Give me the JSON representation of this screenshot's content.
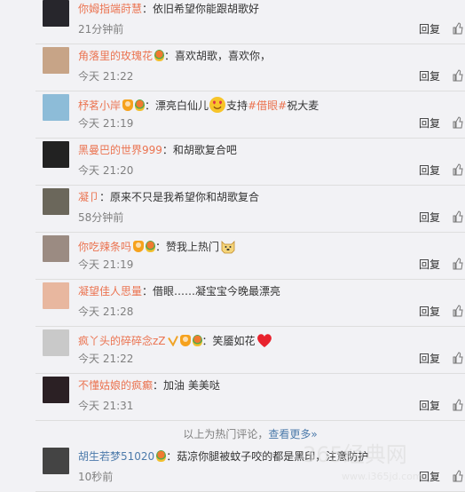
{
  "comments": [
    {
      "user": "你姆指端莳慧",
      "user_color": "#eb7350",
      "badges": [],
      "text": "依旧希望你能跟胡歌好",
      "time": "21分钟前",
      "reply": "回复",
      "avatar": "avatar-dark-portrait"
    },
    {
      "user": "角落里的玫瑰花",
      "user_color": "#eb7350",
      "badges": [
        "balloon"
      ],
      "text": "喜欢胡歌，喜欢你，",
      "time": "今天 21:22",
      "reply": "回复",
      "avatar": "avatar-woman"
    },
    {
      "user": "杼茗小岸",
      "user_color": "#eb7350",
      "badges": [
        "orange",
        "balloon"
      ],
      "text": "漂亮白仙儿",
      "emoji": "heart-eyes-emoji",
      "text2": "支持",
      "tag": "#借眼#",
      "text3": "祝大麦",
      "time": "今天 21:19",
      "reply": "回复",
      "avatar": "avatar-landscape"
    },
    {
      "user": "黑曼巴的世界999",
      "user_color": "#eb7350",
      "badges": [],
      "text": "和胡歌复合吧",
      "time": "今天 21:20",
      "reply": "回复",
      "avatar": "avatar-man-glasses"
    },
    {
      "user": "凝卩",
      "user_color": "#eb7350",
      "badges": [],
      "text": "原来不只是我希望你和胡歌复合",
      "time": "58分钟前",
      "reply": "回复",
      "avatar": "avatar-street"
    },
    {
      "user": "你吃辣条吗",
      "user_color": "#eb7350",
      "badges": [
        "orange",
        "balloon"
      ],
      "text": "赞我上热门",
      "emoji": "doge-emoji",
      "time": "今天 21:19",
      "reply": "回复",
      "avatar": "avatar-interior"
    },
    {
      "user": "凝望佳人思量",
      "user_color": "#eb7350",
      "badges": [],
      "text": "借眼……凝宝宝今晚最漂亮",
      "time": "今天 21:28",
      "reply": "回复",
      "avatar": "avatar-girl"
    },
    {
      "user": "疯丫头的碎碎念zZ",
      "user_color": "#eb7350",
      "badges": [
        "check",
        "orange",
        "balloon"
      ],
      "text": "笑靥如花",
      "emoji": "red-heart-emoji",
      "time": "今天 21:22",
      "reply": "回复",
      "avatar": "avatar-rabbit"
    },
    {
      "user": "不懂姑娘的疯癫",
      "user_color": "#eb7350",
      "badges": [],
      "text": "加油 美美哒",
      "time": "今天 21:31",
      "reply": "回复",
      "avatar": "avatar-portrait-dark-hair"
    },
    {
      "user": "胡生若梦51020",
      "user_color": "#4d7bab",
      "badges": [
        "balloon"
      ],
      "text": "菇凉你腿被蚊子咬的都是黑印，注意防护",
      "time": "10秒前",
      "reply": "回复",
      "avatar": "avatar-dark-figure"
    }
  ],
  "more_bar": {
    "prefix": "以上为热门评论，",
    "link": "查看更多"
  },
  "watermark": {
    "line1": "365经典网",
    "line2": "www.i365jd.com"
  }
}
